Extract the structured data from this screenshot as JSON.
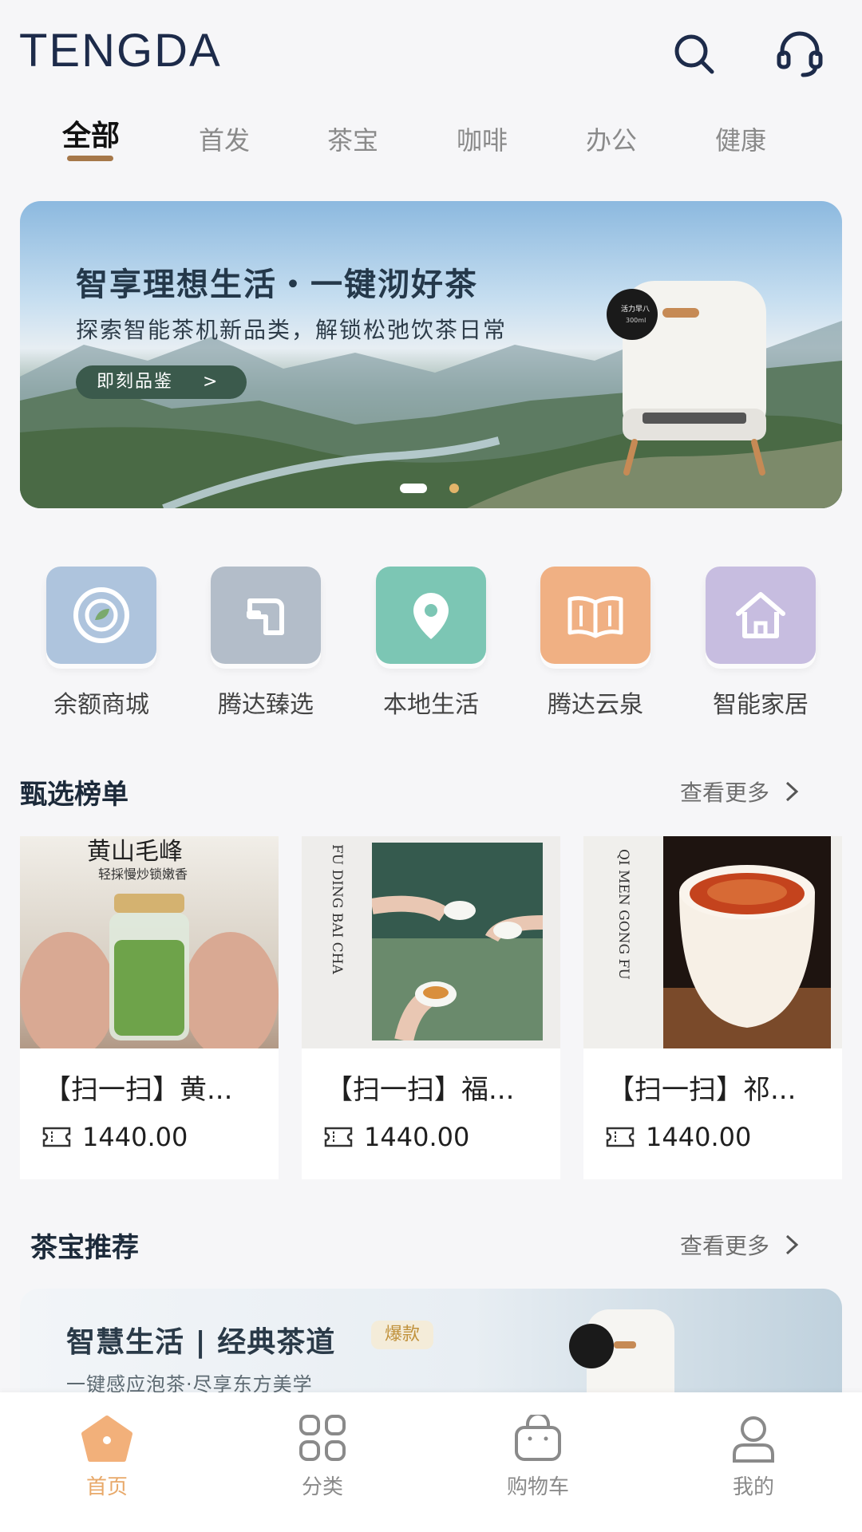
{
  "header": {
    "logo": "TENGDA"
  },
  "tabs": [
    {
      "label": "全部",
      "active": true
    },
    {
      "label": "首发"
    },
    {
      "label": "茶宝"
    },
    {
      "label": "咖啡"
    },
    {
      "label": "办公"
    },
    {
      "label": "健康"
    }
  ],
  "banner": {
    "title": "智享理想生活・一键沏好茶",
    "subtitle": "探索智能茶机新品类，解锁松弛饮茶日常",
    "button": "即刻品鉴",
    "button_arrow": ">",
    "device_screen": "活力早八\n300ml"
  },
  "categories": [
    {
      "label": "余额商城",
      "color": "#aec4dd",
      "icon": "tea-cup-icon"
    },
    {
      "label": "腾达臻选",
      "color": "#b3bdc9",
      "icon": "faucet-icon"
    },
    {
      "label": "本地生活",
      "color": "#7cc6b4",
      "icon": "location-pin-icon"
    },
    {
      "label": "腾达云泉",
      "color": "#f0b083",
      "icon": "book-icon"
    },
    {
      "label": "智能家居",
      "color": "#c7bde0",
      "icon": "home-icon"
    }
  ],
  "ranking": {
    "title": "甄选榜单",
    "more": "查看更多",
    "products": [
      {
        "title": "【扫一扫】黄...",
        "price": "1440.00",
        "img_text_top": "黄山毛峰",
        "img_text_sub": "轻採慢炒锁嫩香"
      },
      {
        "title": "【扫一扫】福...",
        "price": "1440.00",
        "img_side_text": "FU DING BAI CHA"
      },
      {
        "title": "【扫一扫】祁...",
        "price": "1440.00",
        "img_side_text": "QI MEN GONG FU"
      }
    ]
  },
  "recommend": {
    "title": "茶宝推荐",
    "more": "查看更多",
    "card_title": "智慧生活 | 经典茶道",
    "badge": "爆款",
    "subtitle": "一键感应泡茶·尽享东方美学"
  },
  "bottom_nav": [
    {
      "label": "首页",
      "active": true,
      "icon": "home-filled-icon"
    },
    {
      "label": "分类",
      "icon": "grid-icon"
    },
    {
      "label": "购物车",
      "icon": "bag-icon"
    },
    {
      "label": "我的",
      "icon": "user-icon"
    }
  ],
  "colors": {
    "accent": "#a6784a",
    "nav_active": "#e8a96a",
    "bg": "#f6f6f8"
  }
}
